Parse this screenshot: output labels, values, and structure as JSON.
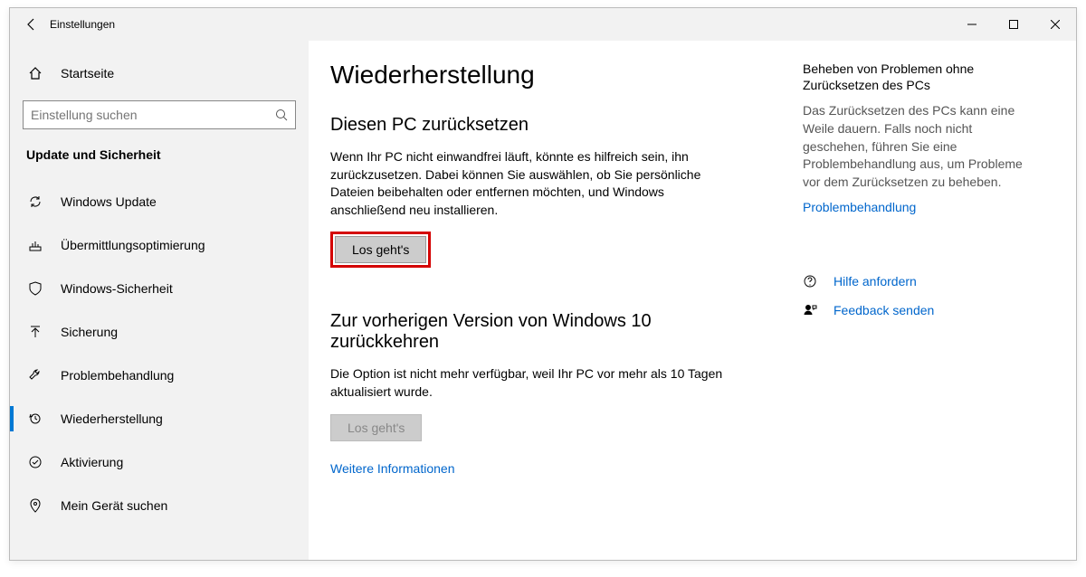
{
  "titlebar": {
    "app_title": "Einstellungen"
  },
  "sidebar": {
    "home_label": "Startseite",
    "search_placeholder": "Einstellung suchen",
    "category": "Update und Sicherheit",
    "items": [
      {
        "label": "Windows Update"
      },
      {
        "label": "Übermittlungsoptimierung"
      },
      {
        "label": "Windows-Sicherheit"
      },
      {
        "label": "Sicherung"
      },
      {
        "label": "Problembehandlung"
      },
      {
        "label": "Wiederherstellung"
      },
      {
        "label": "Aktivierung"
      },
      {
        "label": "Mein Gerät suchen"
      }
    ]
  },
  "main": {
    "page_title": "Wiederherstellung",
    "reset": {
      "heading": "Diesen PC zurücksetzen",
      "body": "Wenn Ihr PC nicht einwandfrei läuft, könnte es hilfreich sein, ihn zurückzusetzen. Dabei können Sie auswählen, ob Sie persönliche Dateien beibehalten oder entfernen möchten, und Windows anschließend neu installieren.",
      "button": "Los geht's"
    },
    "revert": {
      "heading": "Zur vorherigen Version von Windows 10 zurückkehren",
      "body": "Die Option ist nicht mehr verfügbar, weil Ihr PC vor mehr als 10 Tagen aktualisiert wurde.",
      "button": "Los geht's",
      "more_info": "Weitere Informationen"
    }
  },
  "right": {
    "troubleshoot_heading": "Beheben von Problemen ohne Zurücksetzen des PCs",
    "troubleshoot_body": "Das Zurücksetzen des PCs kann eine Weile dauern. Falls noch nicht geschehen, führen Sie eine Problembehandlung aus, um Probleme vor dem Zurücksetzen zu beheben.",
    "troubleshoot_link": "Problembehandlung",
    "help_link": "Hilfe anfordern",
    "feedback_link": "Feedback senden"
  }
}
